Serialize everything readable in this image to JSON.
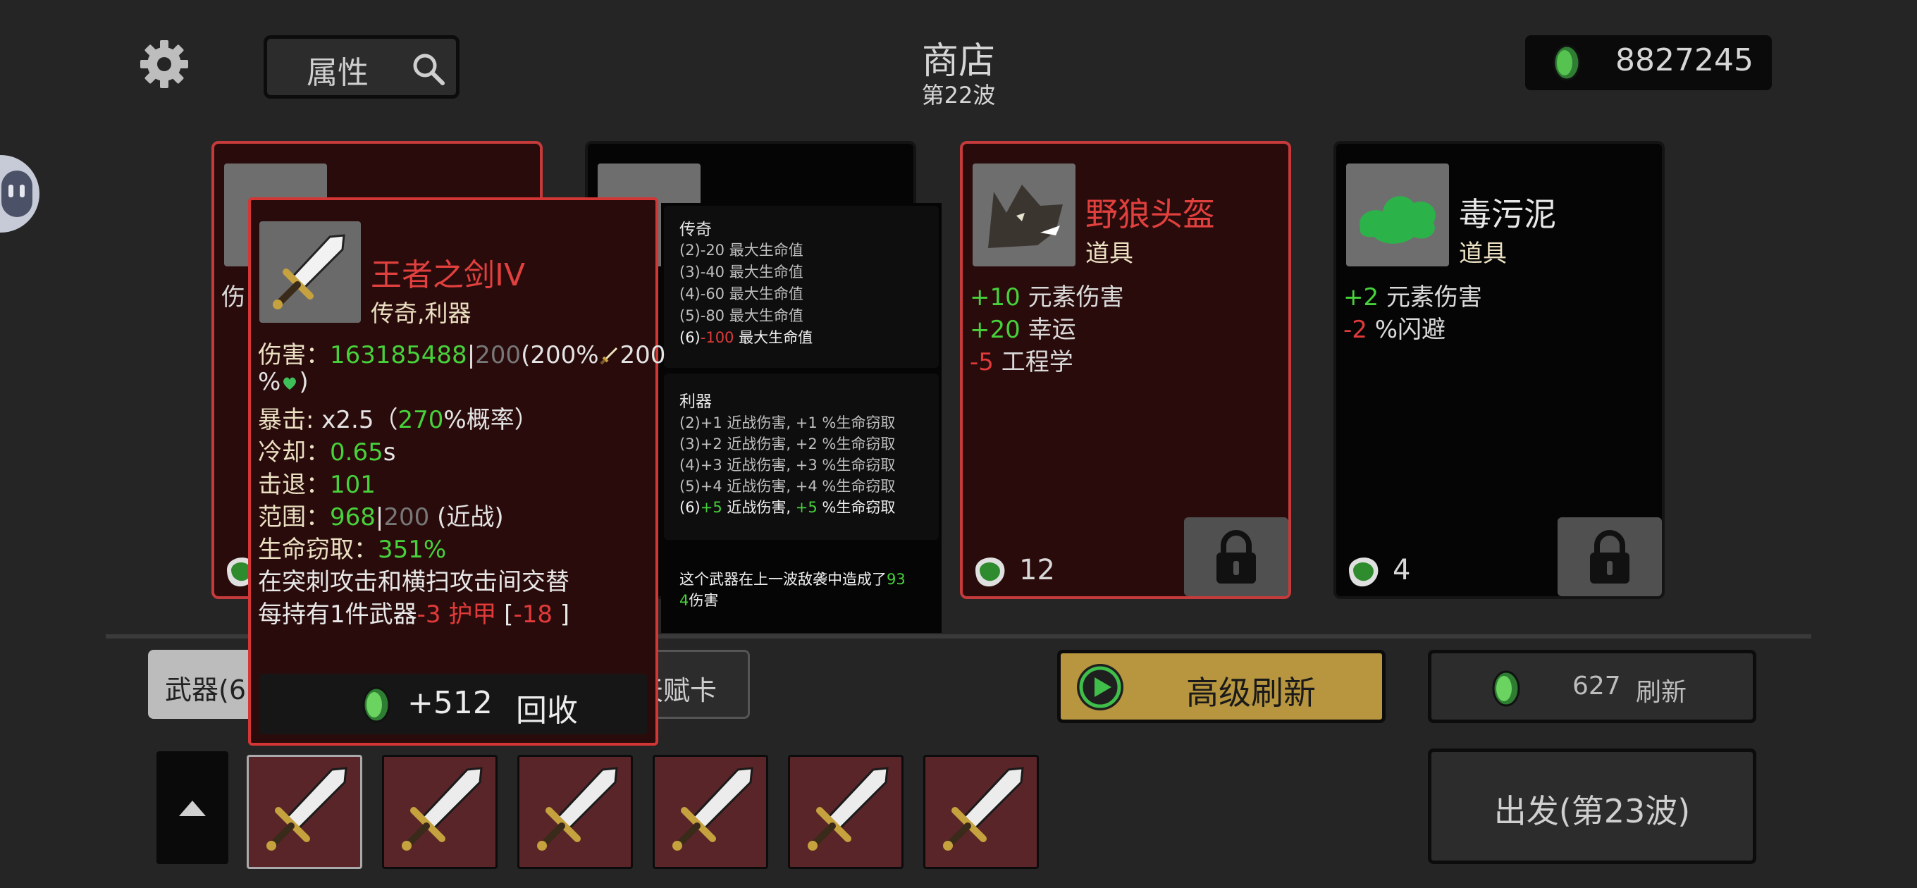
{
  "header": {
    "shop_title": "商店",
    "wave": "第22波",
    "gold": "8827245",
    "search_label": "属性"
  },
  "cards": [
    {
      "name": "",
      "type": "",
      "price": ""
    },
    {
      "name": "",
      "type": "",
      "price": ""
    },
    {
      "name": "野狼头盔",
      "type": "道具",
      "price": "12",
      "stats": [
        {
          "v": "+10",
          "t": "元素伤害"
        },
        {
          "v": "+20",
          "t": "幸运"
        },
        {
          "v": "-5",
          "t": "工程学"
        }
      ]
    },
    {
      "name": "毒污泥",
      "type": "道具",
      "price": "4",
      "stats": [
        {
          "v": "+2",
          "t": "元素伤害"
        },
        {
          "v": "-2",
          "t": "%闪避"
        }
      ]
    }
  ],
  "tooltip": {
    "name": "王者之剑IV",
    "tags": "传奇,利器",
    "damage_label": "伤害：",
    "damage_value": "163185488",
    "damage_sep": "|",
    "damage_base": "200",
    "damage_scaling": "(200%",
    "damage_scaling2": "200",
    "damage_scaling3": "%",
    "damage_close": ")",
    "crit_label": "暴击:",
    "crit_mult": "x2.5（",
    "crit_chance": "270",
    "crit_rest": "%概率）",
    "cooldown_label": "冷却：",
    "cooldown_value": "0.65",
    "cooldown_unit": "s",
    "knockback_label": "击退：",
    "knockback_value": "101",
    "range_label": "范围：",
    "range_value": "968",
    "range_sep": "|",
    "range_base": "200",
    "range_note": " (近战)",
    "lifesteal_label": "生命窃取：",
    "lifesteal_value": "351%",
    "desc1": "在突刺攻击和横扫攻击间交替",
    "desc2_a": "每持有1件武器",
    "desc2_b": "-3 护甲",
    "desc2_c": " [",
    "desc2_d": "-18",
    "desc2_e": " ]",
    "recycle_value": "+512",
    "recycle_label": "回收"
  },
  "set_bonus": {
    "legend_title": "传奇",
    "legend_lines": [
      "(2)-20 最大生命值",
      "(3)-40 最大生命值",
      "(4)-60 最大生命值",
      "(5)-80 最大生命值"
    ],
    "legend_active_a": "(6)",
    "legend_active_b": "-100",
    "legend_active_c": " 最大生命值",
    "sharp_title": "利器",
    "sharp_lines": [
      "(2)+1 近战伤害, +1 %生命窃取",
      "(3)+2 近战伤害, +2 %生命窃取",
      "(4)+3 近战伤害, +3 %生命窃取",
      "(5)+4 近战伤害, +4 %生命窃取"
    ],
    "sharp_active_a": "(6)",
    "sharp_active_b": "+5",
    "sharp_active_c": " 近战伤害, ",
    "sharp_active_d": "+5",
    "sharp_active_e": " %生命窃取",
    "dealt_a": "这个武器在上一波敌袭中造成了",
    "dealt_b": "93",
    "dealt_c": "4",
    "dealt_d": "伤害"
  },
  "bottom": {
    "weapons_tab": "武器(6",
    "talent_tab": "天赋卡",
    "advanced_refresh": "高级刷新",
    "refresh_cost": "627",
    "refresh_label": "刷新",
    "go_label": "出发(第23波)"
  },
  "colors": {
    "accent_red": "#c53a3a",
    "gold": "#b8963f",
    "positive": "#47d13b",
    "negative": "#e03a3a"
  }
}
